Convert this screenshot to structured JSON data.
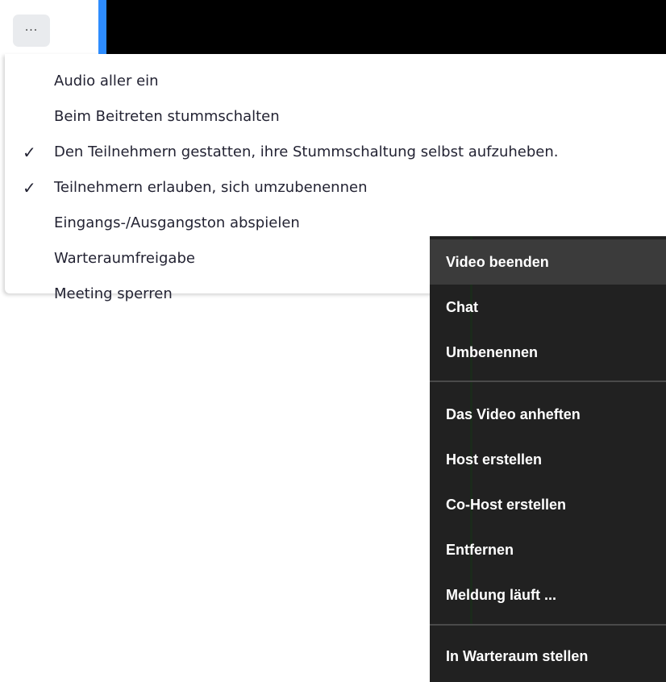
{
  "more_button": {
    "label": "..."
  },
  "settings_menu": {
    "items": [
      {
        "label": "Audio aller ein",
        "checked": false
      },
      {
        "label": "Beim Beitreten stummschalten",
        "checked": false
      },
      {
        "label": "Den Teilnehmern gestatten, ihre Stummschaltung selbst aufzuheben.",
        "checked": true
      },
      {
        "label": "Teilnehmern erlauben, sich umzubenennen",
        "checked": true
      },
      {
        "label": "Eingangs-/Ausgangston abspielen",
        "checked": false
      },
      {
        "label": "Warteraumfreigabe",
        "checked": false
      },
      {
        "label": "Meeting sperren",
        "checked": false
      }
    ],
    "check_glyph": "✓"
  },
  "participant_menu": {
    "items": [
      {
        "label": "Video beenden"
      },
      {
        "label": "Chat"
      },
      {
        "label": "Umbenennen"
      },
      {
        "label": "Das Video anheften"
      },
      {
        "label": "Host erstellen"
      },
      {
        "label": "Co-Host erstellen"
      },
      {
        "label": "Entfernen"
      },
      {
        "label": "Meldung läuft ..."
      },
      {
        "label": "In Warteraum stellen"
      }
    ]
  },
  "colors": {
    "accent_blue": "#2d8cff",
    "dark_menu_bg": "#212121",
    "dark_menu_selected": "#3b3b3b"
  }
}
